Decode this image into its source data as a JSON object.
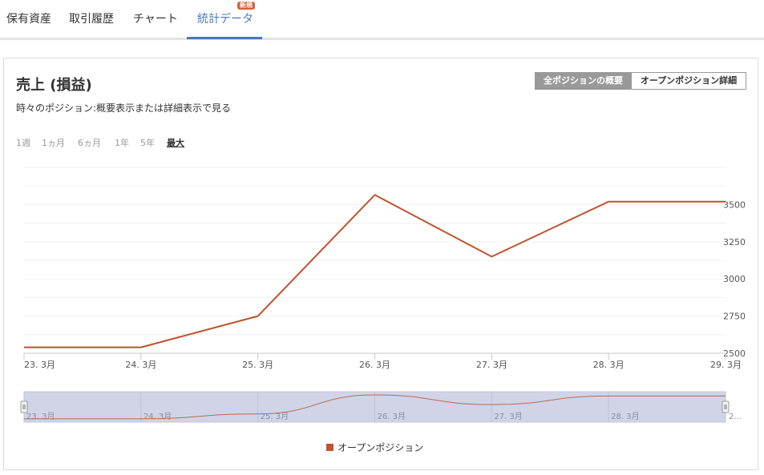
{
  "tabs": [
    {
      "label": "保有資産"
    },
    {
      "label": "取引履歴"
    },
    {
      "label": "チャート"
    },
    {
      "label": "統計データ",
      "badge": "新規"
    }
  ],
  "panel": {
    "title": "売上 (損益)",
    "subtitle": "時々のポジション:概要表示または詳細表示で見る",
    "toggle_summary": "全ポジションの概要",
    "toggle_detail": "オープンポジション詳細",
    "ranges": [
      "1週",
      "1ヵ月",
      "6ヵ月",
      "1年",
      "5年",
      "最大"
    ],
    "selected_range": "最大",
    "navigator_last_label": "2..."
  },
  "colors": {
    "accent": "#4a78c0",
    "series": "#c0522e",
    "navigator_fill": "#d0d4e6",
    "badge": "#d2633a"
  },
  "chart_data": {
    "type": "line",
    "categories": [
      "23. 3月",
      "24. 3月",
      "25. 3月",
      "26. 3月",
      "27. 3月",
      "28. 3月",
      "29. 3月"
    ],
    "series": [
      {
        "name": "オープンポジション",
        "values": [
          2540,
          2540,
          2750,
          3565,
          3150,
          3520,
          3520
        ]
      }
    ],
    "yticks": [
      2500,
      2750,
      3000,
      3250,
      3500
    ],
    "ylim": [
      2500,
      3750
    ],
    "legend": "bottom-center",
    "grid": true
  }
}
